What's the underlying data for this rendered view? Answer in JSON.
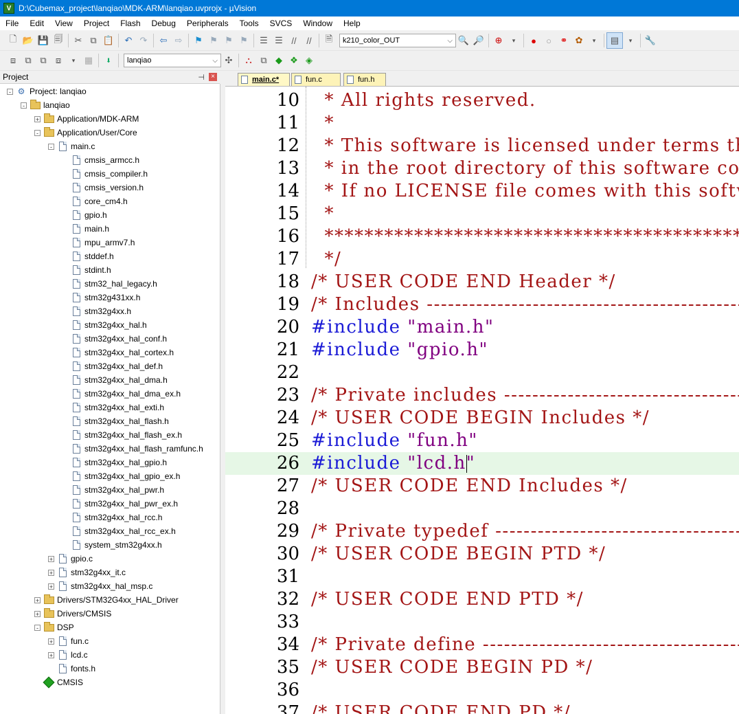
{
  "window": {
    "title": "D:\\Cubemax_project\\lanqiao\\MDK-ARM\\lanqiao.uvprojx - µVision"
  },
  "menu": [
    "File",
    "Edit",
    "View",
    "Project",
    "Flash",
    "Debug",
    "Peripherals",
    "Tools",
    "SVCS",
    "Window",
    "Help"
  ],
  "toolbar": {
    "target_dropdown": "k210_color_OUT",
    "build_target": "lanqiao"
  },
  "project_panel": {
    "title": "Project",
    "pin": "⊣",
    "close": "×",
    "tree": [
      {
        "label": "Project: lanqiao",
        "level": 0,
        "kind": "project",
        "exp": "−"
      },
      {
        "label": "lanqiao",
        "level": 1,
        "kind": "folder",
        "exp": "−"
      },
      {
        "label": "Application/MDK-ARM",
        "level": 2,
        "kind": "folder",
        "exp": "+"
      },
      {
        "label": "Application/User/Core",
        "level": 2,
        "kind": "folder",
        "exp": "−"
      },
      {
        "label": "main.c",
        "level": 3,
        "kind": "file",
        "exp": "−"
      },
      {
        "label": "cmsis_armcc.h",
        "level": 4,
        "kind": "file"
      },
      {
        "label": "cmsis_compiler.h",
        "level": 4,
        "kind": "file"
      },
      {
        "label": "cmsis_version.h",
        "level": 4,
        "kind": "file"
      },
      {
        "label": "core_cm4.h",
        "level": 4,
        "kind": "file"
      },
      {
        "label": "gpio.h",
        "level": 4,
        "kind": "file"
      },
      {
        "label": "main.h",
        "level": 4,
        "kind": "file"
      },
      {
        "label": "mpu_armv7.h",
        "level": 4,
        "kind": "file"
      },
      {
        "label": "stddef.h",
        "level": 4,
        "kind": "file"
      },
      {
        "label": "stdint.h",
        "level": 4,
        "kind": "file"
      },
      {
        "label": "stm32_hal_legacy.h",
        "level": 4,
        "kind": "file"
      },
      {
        "label": "stm32g431xx.h",
        "level": 4,
        "kind": "file"
      },
      {
        "label": "stm32g4xx.h",
        "level": 4,
        "kind": "file"
      },
      {
        "label": "stm32g4xx_hal.h",
        "level": 4,
        "kind": "file"
      },
      {
        "label": "stm32g4xx_hal_conf.h",
        "level": 4,
        "kind": "file"
      },
      {
        "label": "stm32g4xx_hal_cortex.h",
        "level": 4,
        "kind": "file"
      },
      {
        "label": "stm32g4xx_hal_def.h",
        "level": 4,
        "kind": "file"
      },
      {
        "label": "stm32g4xx_hal_dma.h",
        "level": 4,
        "kind": "file"
      },
      {
        "label": "stm32g4xx_hal_dma_ex.h",
        "level": 4,
        "kind": "file"
      },
      {
        "label": "stm32g4xx_hal_exti.h",
        "level": 4,
        "kind": "file"
      },
      {
        "label": "stm32g4xx_hal_flash.h",
        "level": 4,
        "kind": "file"
      },
      {
        "label": "stm32g4xx_hal_flash_ex.h",
        "level": 4,
        "kind": "file"
      },
      {
        "label": "stm32g4xx_hal_flash_ramfunc.h",
        "level": 4,
        "kind": "file"
      },
      {
        "label": "stm32g4xx_hal_gpio.h",
        "level": 4,
        "kind": "file"
      },
      {
        "label": "stm32g4xx_hal_gpio_ex.h",
        "level": 4,
        "kind": "file"
      },
      {
        "label": "stm32g4xx_hal_pwr.h",
        "level": 4,
        "kind": "file"
      },
      {
        "label": "stm32g4xx_hal_pwr_ex.h",
        "level": 4,
        "kind": "file"
      },
      {
        "label": "stm32g4xx_hal_rcc.h",
        "level": 4,
        "kind": "file"
      },
      {
        "label": "stm32g4xx_hal_rcc_ex.h",
        "level": 4,
        "kind": "file"
      },
      {
        "label": "system_stm32g4xx.h",
        "level": 4,
        "kind": "file"
      },
      {
        "label": "gpio.c",
        "level": 3,
        "kind": "file",
        "exp": "+"
      },
      {
        "label": "stm32g4xx_it.c",
        "level": 3,
        "kind": "file",
        "exp": "+"
      },
      {
        "label": "stm32g4xx_hal_msp.c",
        "level": 3,
        "kind": "file",
        "exp": "+"
      },
      {
        "label": "Drivers/STM32G4xx_HAL_Driver",
        "level": 2,
        "kind": "folder",
        "exp": "+"
      },
      {
        "label": "Drivers/CMSIS",
        "level": 2,
        "kind": "folder",
        "exp": "+"
      },
      {
        "label": "DSP",
        "level": 2,
        "kind": "folder",
        "exp": "−"
      },
      {
        "label": "fun.c",
        "level": 3,
        "kind": "file",
        "exp": "+"
      },
      {
        "label": "lcd.c",
        "level": 3,
        "kind": "file",
        "exp": "+"
      },
      {
        "label": "fonts.h",
        "level": 3,
        "kind": "file"
      },
      {
        "label": "CMSIS",
        "level": 2,
        "kind": "cmsis"
      }
    ]
  },
  "tabs": [
    {
      "label": "main.c*",
      "active": true
    },
    {
      "label": "fun.c",
      "active": false
    },
    {
      "label": "fun.h",
      "active": false
    }
  ],
  "editor": {
    "lines": [
      {
        "n": "10",
        "parts": [
          [
            "cmt",
            "  * All rights reserved."
          ]
        ]
      },
      {
        "n": "11",
        "parts": [
          [
            "cmt",
            "  *"
          ]
        ]
      },
      {
        "n": "12",
        "parts": [
          [
            "cmt",
            "  * This software is licensed under terms that can be found in the LICENSE file"
          ]
        ]
      },
      {
        "n": "13",
        "parts": [
          [
            "cmt",
            "  * in the root directory of this software component."
          ]
        ]
      },
      {
        "n": "14",
        "parts": [
          [
            "cmt",
            "  * If no LICENSE file comes with this software, it is provided AS-IS."
          ]
        ]
      },
      {
        "n": "15",
        "parts": [
          [
            "cmt",
            "  *"
          ]
        ]
      },
      {
        "n": "16",
        "parts": [
          [
            "cmt",
            "  ******************************************************************************"
          ]
        ]
      },
      {
        "n": "17",
        "parts": [
          [
            "cmt",
            "  */"
          ]
        ]
      },
      {
        "n": "18",
        "parts": [
          [
            "cmt",
            "/* USER CODE END Header */"
          ]
        ]
      },
      {
        "n": "19",
        "parts": [
          [
            "cmt",
            "/* Includes ------------------------------------------------------------------*/"
          ]
        ]
      },
      {
        "n": "20",
        "parts": [
          [
            "kw",
            "#include "
          ],
          [
            "str",
            "\"main.h\""
          ]
        ]
      },
      {
        "n": "21",
        "parts": [
          [
            "kw",
            "#include "
          ],
          [
            "str",
            "\"gpio.h\""
          ]
        ]
      },
      {
        "n": "22",
        "parts": []
      },
      {
        "n": "23",
        "parts": [
          [
            "cmt",
            "/* Private includes ----------------------------------------------------------*/"
          ]
        ]
      },
      {
        "n": "24",
        "parts": [
          [
            "cmt",
            "/* USER CODE BEGIN Includes */"
          ]
        ]
      },
      {
        "n": "25",
        "parts": [
          [
            "kw",
            "#include "
          ],
          [
            "str",
            "\"fun.h\""
          ]
        ]
      },
      {
        "n": "26",
        "parts": [
          [
            "kw",
            "#include "
          ],
          [
            "str",
            "\"lcd.h"
          ],
          [
            "cursor",
            ""
          ],
          [
            "str",
            "\""
          ]
        ],
        "hl": true
      },
      {
        "n": "27",
        "parts": [
          [
            "cmt",
            "/* USER CODE END Includes */"
          ]
        ]
      },
      {
        "n": "28",
        "parts": []
      },
      {
        "n": "29",
        "parts": [
          [
            "cmt",
            "/* Private typedef -----------------------------------------------------------*/"
          ]
        ]
      },
      {
        "n": "30",
        "parts": [
          [
            "cmt",
            "/* USER CODE BEGIN PTD */"
          ]
        ]
      },
      {
        "n": "31",
        "parts": []
      },
      {
        "n": "32",
        "parts": [
          [
            "cmt",
            "/* USER CODE END PTD */"
          ]
        ]
      },
      {
        "n": "33",
        "parts": []
      },
      {
        "n": "34",
        "parts": [
          [
            "cmt",
            "/* Private define ------------------------------------------------------------*/"
          ]
        ]
      },
      {
        "n": "35",
        "parts": [
          [
            "cmt",
            "/* USER CODE BEGIN PD */"
          ]
        ]
      },
      {
        "n": "36",
        "parts": []
      },
      {
        "n": "37",
        "parts": [
          [
            "cmt",
            "/* USER CODE END PD */"
          ]
        ]
      }
    ]
  }
}
